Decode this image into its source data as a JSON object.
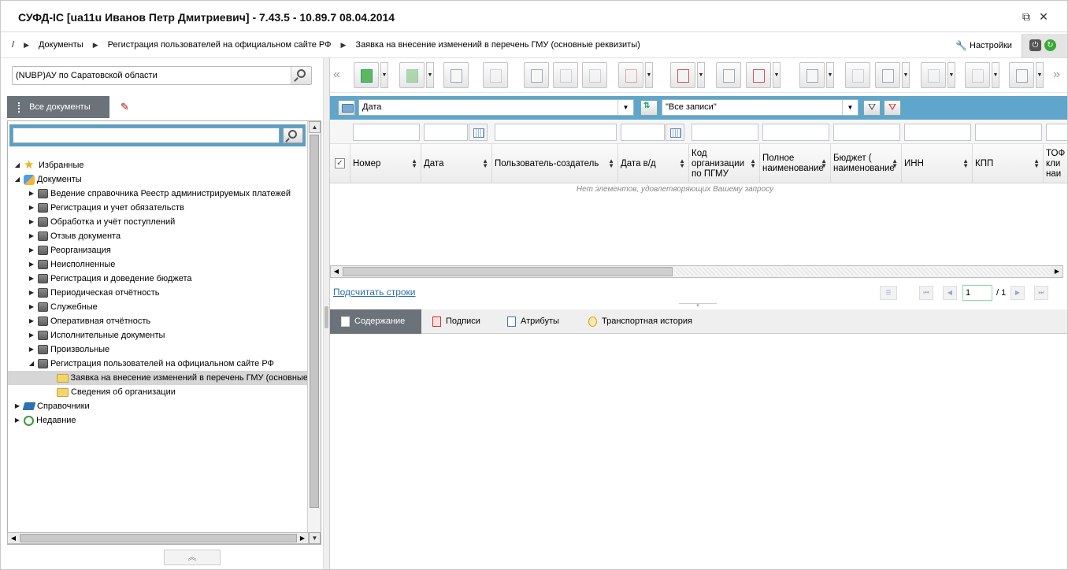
{
  "window": {
    "title": "СУФД-IC [ua11u Иванов Петр Дмитриевич] - 7.43.5 - 10.89.7 08.04.2014"
  },
  "breadcrumb": {
    "root": "/",
    "items": [
      "Документы",
      "Регистрация пользователей на официальном сайте РФ",
      "Заявка на внесение изменений в перечень ГМУ (основные реквизиты)"
    ],
    "settings_label": "Настройки"
  },
  "left": {
    "org_value": "(NUBP)АУ по Саратовской области",
    "tabs": {
      "all_docs": "Все документы"
    },
    "tree": {
      "favorites": "Избранные",
      "documents": "Документы",
      "doc_items": [
        "Ведение справочника Реестр администрируемых платежей",
        "Регистрация и учет обязательств",
        "Обработка и учёт поступлений",
        "Отзыв документа",
        "Реорганизация",
        "Неисполненные",
        "Регистрация и доведение бюджета",
        "Периодическая отчётность",
        "Служебные",
        "Оперативная отчётность",
        "Исполнительные документы",
        "Произвольные"
      ],
      "reg_users": "Регистрация пользователей на официальном сайте РФ",
      "reg_children": [
        "Заявка на внесение изменений в перечень ГМУ (основные",
        "Сведения об организации"
      ],
      "references": "Справочники",
      "recent": "Недавние"
    }
  },
  "filter": {
    "sort_field": "Дата",
    "records": "\"Все записи\""
  },
  "grid": {
    "columns": [
      {
        "label": "Номер"
      },
      {
        "label": "Дата"
      },
      {
        "label": "Пользователь-создатель"
      },
      {
        "label": "Дата в/д"
      },
      {
        "label": "Код организации по ПГМУ"
      },
      {
        "label": "Полное наименование"
      },
      {
        "label": "Бюджет ( наименование"
      },
      {
        "label": "ИНН"
      },
      {
        "label": "КПП"
      },
      {
        "label": "ТОФ кли наи"
      }
    ],
    "empty_message": "Нет элементов, удовлетворяющих Вашему запросу"
  },
  "pager": {
    "count_link": "Подсчитать строки",
    "page": "1",
    "total": "/ 1"
  },
  "bottom_tabs": [
    "Содержание",
    "Подписи",
    "Атрибуты",
    "Транспортная история"
  ]
}
